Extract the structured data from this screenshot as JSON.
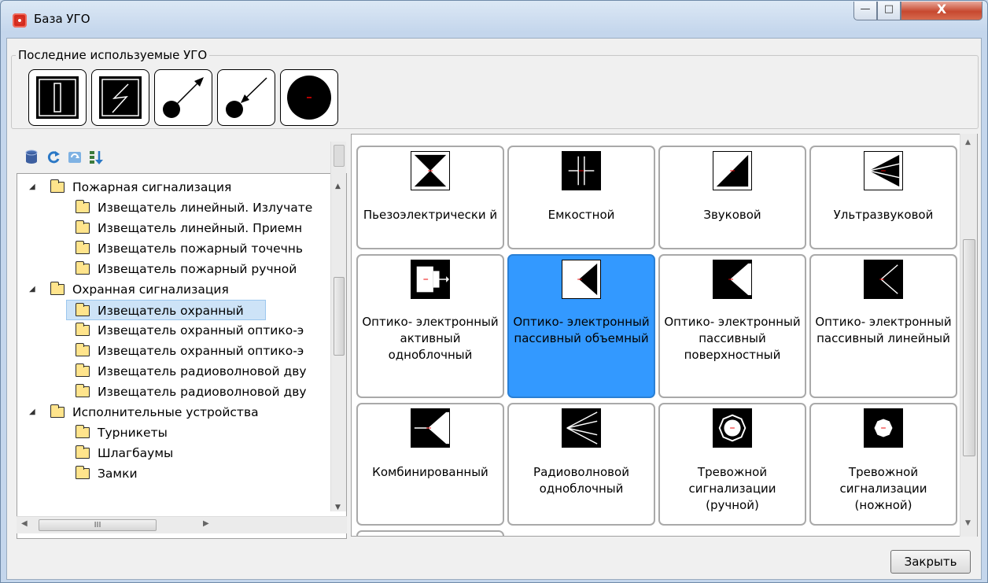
{
  "window": {
    "title": "База УГО",
    "controls": {
      "minimize": "—",
      "maximize": "□",
      "close": "X"
    }
  },
  "recent": {
    "legend": "Последние используемые УГО",
    "items": [
      {
        "icon": "vertical-bar-symbol-icon"
      },
      {
        "icon": "lightning-symbol-icon"
      },
      {
        "icon": "emitter-arrow-symbol-icon"
      },
      {
        "icon": "receiver-arrow-symbol-icon"
      },
      {
        "icon": "filled-circle-symbol-icon"
      }
    ]
  },
  "toolbar": {
    "icons": [
      "database-icon",
      "refresh-icon",
      "sync-icon",
      "sort-icon"
    ]
  },
  "tree": {
    "items": [
      {
        "label": "Пожарная сигнализация",
        "level": 0,
        "expanded": true
      },
      {
        "label": "Извещатель линейный. Излучате",
        "level": 1
      },
      {
        "label": "Извещатель линейный. Приемн",
        "level": 1
      },
      {
        "label": "Извещатель пожарный точечнь",
        "level": 1
      },
      {
        "label": "Извещатель пожарный ручной",
        "level": 1
      },
      {
        "label": "Охранная сигнализация",
        "level": 0,
        "expanded": true
      },
      {
        "label": "Извещатель охранный",
        "level": 1,
        "selected": true
      },
      {
        "label": "Извещатель охранный оптико-э",
        "level": 1
      },
      {
        "label": "Извещатель охранный оптико-э",
        "level": 1
      },
      {
        "label": "Извещатель радиоволновой дву",
        "level": 1
      },
      {
        "label": "Извещатель радиоволновой дву",
        "level": 1
      },
      {
        "label": "Исполнительные устройства",
        "level": 0,
        "expanded": true
      },
      {
        "label": "Турникеты",
        "level": 1
      },
      {
        "label": "Шлагбаумы",
        "level": 1
      },
      {
        "label": "Замки",
        "level": 1
      }
    ],
    "hscroll_thumb": "III"
  },
  "grid": {
    "cards": [
      {
        "label": "Пьезоэлектрически й",
        "icon": "hourglass-symbol-icon"
      },
      {
        "label": "Емкостной",
        "icon": "capacitive-symbol-icon"
      },
      {
        "label": "Звуковой",
        "icon": "diagonal-triangle-symbol-icon"
      },
      {
        "label": "Ультразвуковой",
        "icon": "arrowhead-left-symbol-icon"
      },
      {
        "label": "Оптико- электронный активный одноблочный",
        "icon": "optical-active-symbol-icon"
      },
      {
        "label": "Оптико- электронный пассивный объемный",
        "icon": "optical-volumetric-symbol-icon",
        "selected": true
      },
      {
        "label": "Оптико- электронный пассивный поверхностный",
        "icon": "optical-surface-symbol-icon"
      },
      {
        "label": "Оптико- электронный пассивный линейный",
        "icon": "optical-linear-symbol-icon"
      },
      {
        "label": "Комбинированный",
        "icon": "combined-symbol-icon"
      },
      {
        "label": "Радиоволновой одноблочный",
        "icon": "radiowave-symbol-icon"
      },
      {
        "label": "Тревожной сигнализации (ручной)",
        "icon": "alarm-manual-symbol-icon"
      },
      {
        "label": "Тревожной сигнализации (ножной)",
        "icon": "alarm-foot-symbol-icon"
      }
    ]
  },
  "footer": {
    "close_label": "Закрыть"
  }
}
